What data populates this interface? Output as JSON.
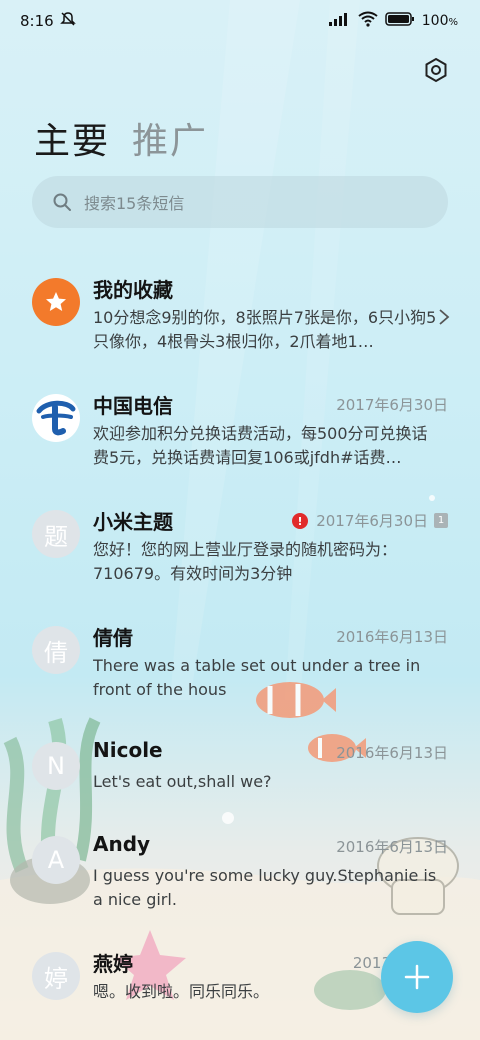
{
  "status_bar": {
    "time": "8:16",
    "battery": "100"
  },
  "tabs": [
    {
      "label": "主要",
      "active": true
    },
    {
      "label": "推广",
      "active": false
    }
  ],
  "search": {
    "placeholder": "搜索15条短信"
  },
  "conversations": [
    {
      "name": "我的收藏",
      "date": "",
      "preview": "10分想念9别的你，8张照片7张是你，6只小狗5只像你，4根骨头3根归你，2爪着地1…",
      "avatar": "star-icon",
      "avatar_color": "#f37a2b"
    },
    {
      "name": "中国电信",
      "date": "2017年6月30日",
      "preview": "欢迎参加积分兑换话费活动，每500分可兑换话费5元，兑换话费请回复106或jfdh#话费…",
      "avatar": "china-telecom-logo-icon"
    },
    {
      "name": "小米主题",
      "date": "2017年6月30日",
      "preview": "您好！您的网上营业厅登录的随机密码为：710679。有效时间为3分钟",
      "avatar_text": "题",
      "sim": "1"
    },
    {
      "name": "倩倩",
      "date": "2016年6月13日",
      "preview": "There was a table set out under a tree in front of the hous",
      "avatar_text": "倩"
    },
    {
      "name": "Nicole",
      "date": "2016年6月13日",
      "preview": "Let's eat out,shall we?",
      "avatar_text": "N"
    },
    {
      "name": "Andy",
      "date": "2016年6月13日",
      "preview": "I guess you're some lucky guy.Stephanie is a nice girl.",
      "avatar_text": "A"
    },
    {
      "name": "燕婷",
      "date": "2013年",
      "preview": "嗯。收到啦。同乐同乐。",
      "avatar_text": "婷"
    }
  ],
  "colors": {
    "accent": "#5cc6e6",
    "alert": "#e12b2b",
    "favorite": "#f37a2b"
  }
}
